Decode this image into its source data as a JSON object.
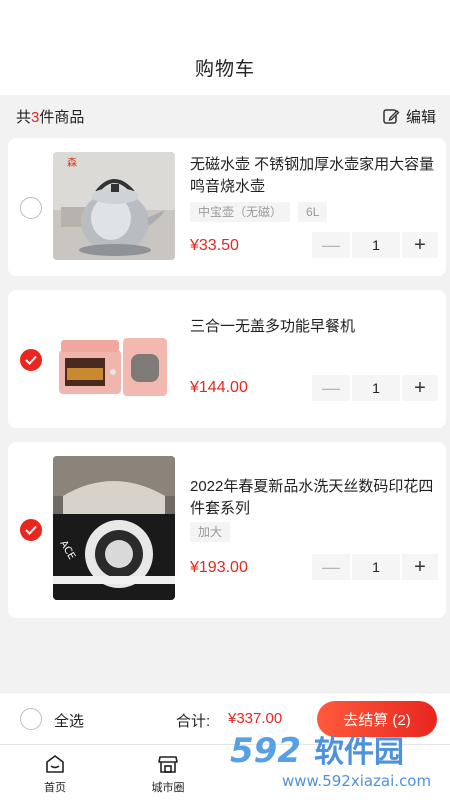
{
  "header": {
    "title": "购物车"
  },
  "summary": {
    "prefix": "共",
    "count": "3",
    "suffix": "件商品",
    "edit_label": "编辑"
  },
  "items": [
    {
      "name": "无磁水壶 不锈钢加厚水壶家用大容量鸣音烧水壶",
      "tags": [
        "中宝壶（无磁）",
        "6L"
      ],
      "price": "¥33.50",
      "quantity": "1",
      "checked": false,
      "image_icon": "kettle-image"
    },
    {
      "name": "三合一无盖多功能早餐机",
      "tags": [],
      "price": "¥144.00",
      "quantity": "1",
      "checked": true,
      "image_icon": "breakfast-machine-image"
    },
    {
      "name": "2022年春夏新品水洗天丝数码印花四件套系列",
      "tags": [
        "加大"
      ],
      "price": "¥193.00",
      "quantity": "1",
      "checked": true,
      "image_icon": "bedding-set-image"
    }
  ],
  "footer": {
    "select_all_label": "全选",
    "total_label": "合计:",
    "total_value": "¥337.00",
    "checkout_label": "去结算 (2)"
  },
  "tabbar": {
    "items": [
      {
        "label": "首页",
        "icon": "home-icon"
      },
      {
        "label": "城市圈",
        "icon": "store-icon"
      }
    ]
  },
  "watermark": {
    "brand": "592软件园",
    "url": "www.592xiazai.com"
  },
  "colors": {
    "accent": "#e8261f",
    "background": "#f2f2f2",
    "card": "#ffffff"
  }
}
